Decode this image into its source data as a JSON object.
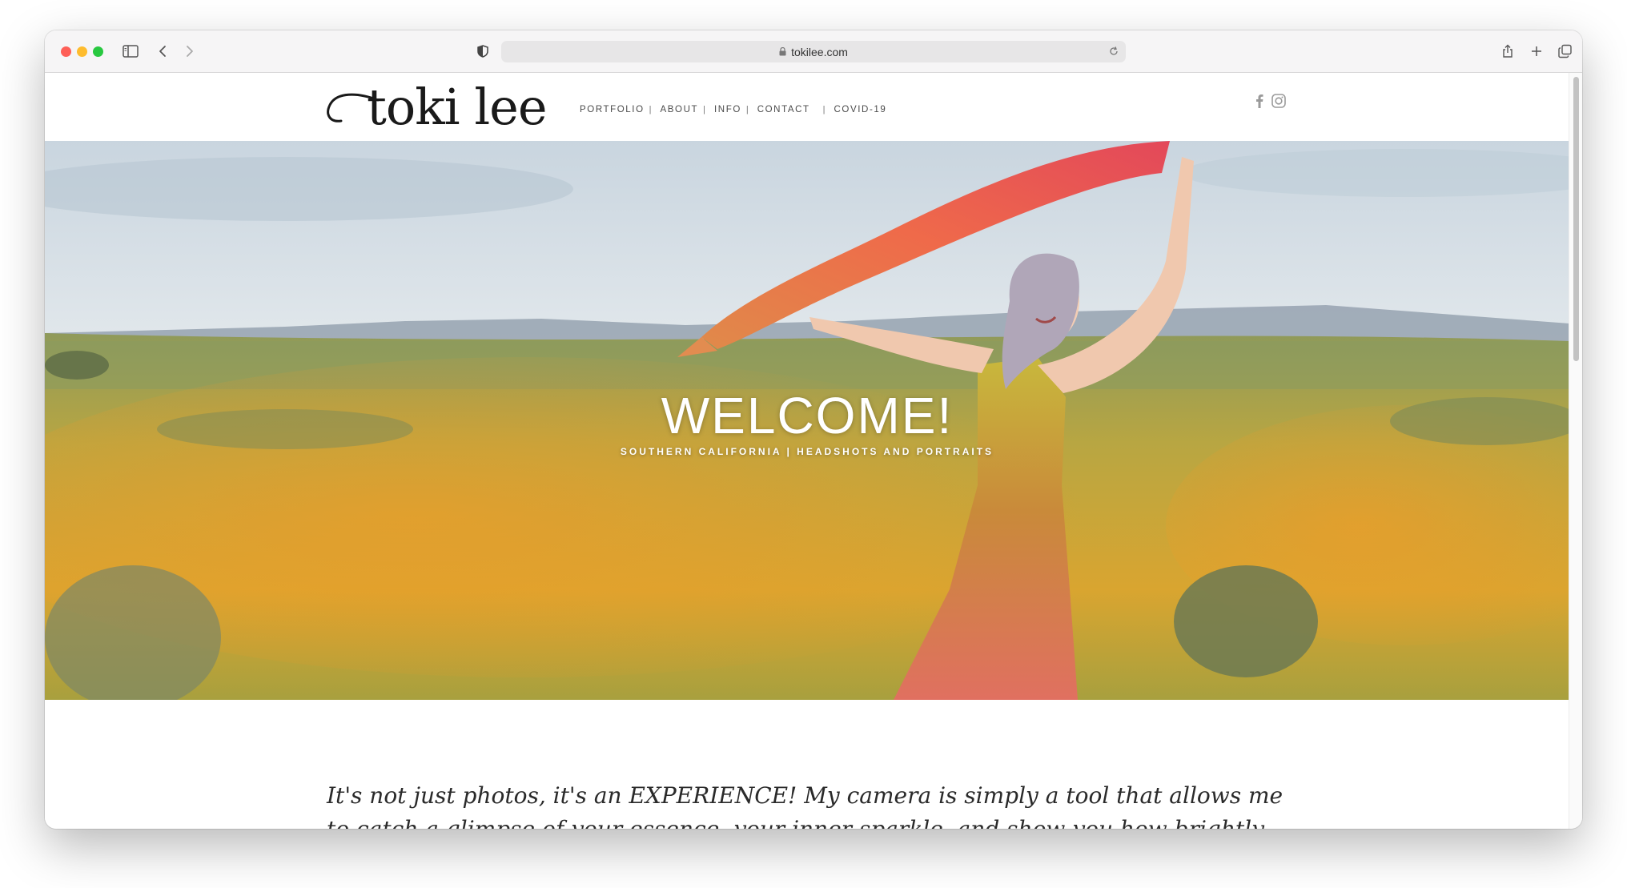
{
  "browser": {
    "url": "tokilee.com",
    "colors": {
      "close": "#fe5f57",
      "minimize": "#febc2e",
      "zoom": "#28c840"
    },
    "icons": [
      "sidebar-icon",
      "back-icon",
      "forward-icon",
      "shield-icon",
      "lock-icon",
      "reload-icon",
      "share-icon",
      "new-tab-icon",
      "tabs-overview-icon"
    ]
  },
  "site": {
    "logo_text": "toki lee",
    "nav": [
      {
        "label": "PORTFOLIO"
      },
      {
        "label": "ABOUT"
      },
      {
        "label": "INFO"
      },
      {
        "label": "CONTACT"
      },
      {
        "label": "COVID-19"
      }
    ],
    "nav_separator": "|",
    "social": [
      "facebook-icon",
      "instagram-icon"
    ]
  },
  "hero": {
    "title": "WELCOME!",
    "subtitle": "SOUTHERN CALIFORNIA | HEADSHOTS AND PORTRAITS"
  },
  "intro": {
    "text": "It's not just photos, it's an EXPERIENCE!  My camera is simply a tool that allows me to catch a glimpse of your essence, your inner sparkle, and show you how brightly you shine.  My mission is to"
  }
}
